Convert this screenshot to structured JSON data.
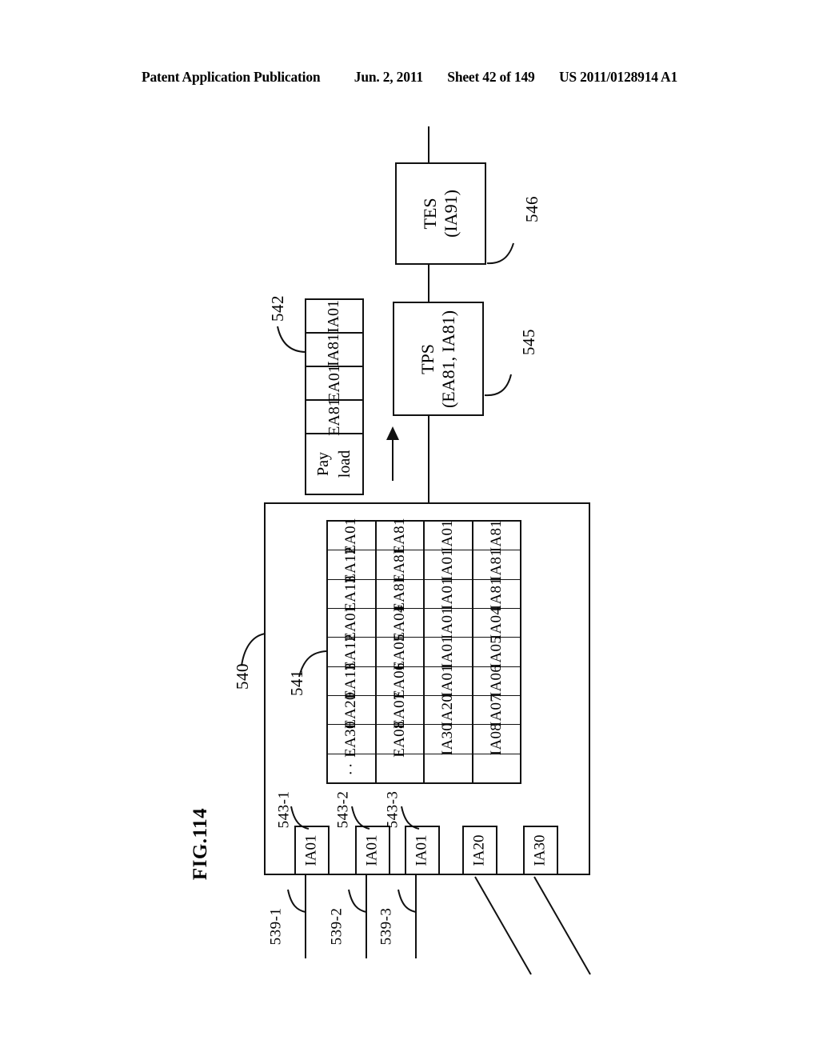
{
  "header": {
    "publication": "Patent Application Publication",
    "date": "Jun. 2, 2011",
    "sheet": "Sheet 42 of 149",
    "patent_number": "US 2011/0128914 A1"
  },
  "figure": {
    "label": "FIG.114"
  },
  "blocks": {
    "tes": {
      "title": "TES",
      "subtitle": "(IA91)",
      "ref": "546"
    },
    "tps": {
      "title": "TPS",
      "subtitle": "(EA81, IA81)",
      "ref": "545"
    },
    "main_block_ref": "540",
    "table_ref": "541"
  },
  "packet": {
    "ref": "542",
    "fields": [
      {
        "label": "IA01"
      },
      {
        "label": "IA81"
      },
      {
        "label": "EA01"
      },
      {
        "label": "EA81"
      },
      {
        "label": "Pay load",
        "line1": "Pay",
        "line2": "load"
      }
    ]
  },
  "table": {
    "ref": "541",
    "columns": [
      {
        "name": "col-1",
        "cells": [
          "EA01",
          "EA12",
          "EA13",
          "EA01",
          "EA12",
          "EA13",
          "EA20",
          "EA30",
          "··"
        ]
      },
      {
        "name": "col-2",
        "cells": [
          "EA81",
          "EA81",
          "EA81",
          "EA04",
          "EA05",
          "EA06",
          "EA07",
          "EA08",
          ""
        ]
      },
      {
        "name": "col-3",
        "cells": [
          "IA01",
          "IA01",
          "IA01",
          "IA01",
          "IA01",
          "IA01",
          "IA20",
          "IA30",
          ""
        ]
      },
      {
        "name": "col-4",
        "cells": [
          "IA81",
          "IA81",
          "IA81",
          "IA04",
          "IA05",
          "IA06",
          "IA07",
          "IA08",
          ""
        ]
      }
    ]
  },
  "interfaces": {
    "boxes": [
      {
        "label": "IA01",
        "ref": "543-1",
        "line_ref": "539-1"
      },
      {
        "label": "IA01",
        "ref": "543-2",
        "line_ref": "539-2"
      },
      {
        "label": "IA01",
        "ref": "543-3",
        "line_ref": "539-3"
      },
      {
        "label": "IA20",
        "ref": "",
        "line_ref": ""
      },
      {
        "label": "IA30",
        "ref": "",
        "line_ref": ""
      }
    ]
  },
  "refs": {
    "r540": "540",
    "r541": "541",
    "r542": "542",
    "r543_1": "543-1",
    "r543_2": "543-2",
    "r543_3": "543-3",
    "r545": "545",
    "r546": "546",
    "r539_1": "539-1",
    "r539_2": "539-2",
    "r539_3": "539-3"
  },
  "colors": {
    "ink": "#111111",
    "paper": "#ffffff"
  }
}
